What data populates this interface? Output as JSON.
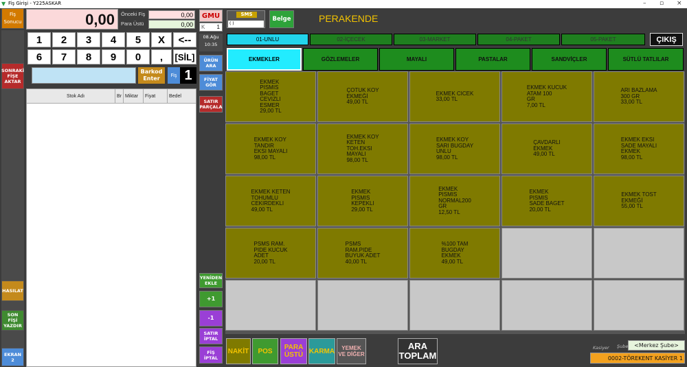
{
  "window": {
    "title": "Fiş Girişi - Y225ASKAR"
  },
  "left_rail": {
    "fis_sonucu": "Fiş Sonucu",
    "sonraki_fise_aktar": "SONRAKİ FİŞE AKTAR",
    "hasilat": "HASILAT",
    "son_fisi_yazdir": "SON FİŞİ YAZDIR",
    "ekran": "EKRAN 2"
  },
  "totals": {
    "total": "0,00",
    "onceki_fis_label": "Önceki Fiş",
    "onceki_fis_value": "0,00",
    "para_ustu_label": "Para Üstü",
    "para_ustu_value": "0,00"
  },
  "keypad": {
    "row1": [
      "1",
      "2",
      "3",
      "4",
      "5",
      "X",
      "<--"
    ],
    "row2": [
      "6",
      "7",
      "8",
      "9",
      "0",
      ",",
      "[SİL]"
    ]
  },
  "barcode": {
    "value": "",
    "enter_label": "Barkod Enter",
    "fis_label": "Fiş",
    "fis_number": "1"
  },
  "receipt": {
    "columns": [
      "Stok Adı",
      "Br",
      "Miktar",
      "Fiyat",
      "Bedel"
    ]
  },
  "mid_rail": {
    "gmu": "GMU",
    "k_label": "K",
    "k_value": "1",
    "date": "08.Ağu",
    "time": "10:35",
    "urun_ara": "ÜRÜN ARA",
    "fiyat_gor": "FİYAT GÖR",
    "satir_parcala": "SATIR PARÇALA",
    "yeniden_ekle": "YENİDEN EKLE",
    "plus1": "+1",
    "minus1": "-1",
    "satir_iptal": "SATIR İPTAL",
    "fis_iptal": "FİŞ İPTAL"
  },
  "top": {
    "sms_label": "SMS",
    "sms_value": "( )",
    "belge": "Belge",
    "mode": "PERAKENDE",
    "cikis": "ÇIKIŞ"
  },
  "categories": [
    "01-UNLU",
    "02-İÇECEK",
    "03-MARKET",
    "04-PAKET",
    "05-PAKET"
  ],
  "subcategories": [
    "EKMEKLER",
    "GÖZLEMELER",
    "MAYALI",
    "PASTALAR",
    "SANDVİÇLER",
    "SÜTLÜ TATLILAR"
  ],
  "products": [
    {
      "name": "EKMEK\nPISMIS\nBAGET\nCEVIZLI\nESMER",
      "price": "29,00 TL"
    },
    {
      "name": "ÇOTUK KOY\nEKMEĞİ",
      "price": "49,00 TL"
    },
    {
      "name": "EKMEK CICEK",
      "price": "33,00 TL"
    },
    {
      "name": "EKMEK KUCUK\nATAM 100\nGR",
      "price": "7,00 TL"
    },
    {
      "name": "ARI BAZLAMA\n300 GR",
      "price": "33,00 TL"
    },
    {
      "name": "EKMEK KOY\nTANDIR\nEKSI MAYALI",
      "price": "98,00 TL"
    },
    {
      "name": "EKMEK KOY\nKETEN\nTOH.EKSI\nMAYALI",
      "price": "98,00 TL"
    },
    {
      "name": "EKMEK KOY\nSARI BUGDAY\nUNLU",
      "price": "98,00 TL"
    },
    {
      "name": "ÇAVDARLI\nEKMEK",
      "price": "49,00 TL"
    },
    {
      "name": "EKMEK EKSI\nSADE MAYALI\nEKMEK",
      "price": "98,00 TL"
    },
    {
      "name": "EKMEK KETEN\nTOHUMLU\nCEKIRDEKLI",
      "price": "49,00 TL"
    },
    {
      "name": "EKMEK\nPISMIS\nKEPEKLI",
      "price": "29,00 TL"
    },
    {
      "name": "EKMEK\nPISMIS\nNORMAL200\nGR",
      "price": "12,50 TL"
    },
    {
      "name": "EKMEK\nPISMIS\nSADE BAGET",
      "price": "20,00 TL"
    },
    {
      "name": "EKMEK TOST\nEKMEĞİ",
      "price": "55,00 TL"
    },
    {
      "name": "PSMS RAM.\nPIDE KUCUK\nADET",
      "price": "20,00 TL"
    },
    {
      "name": "PSMS\nRAM.PIDE\nBUYUK ADET",
      "price": "40,00 TL"
    },
    {
      "name": "%100 TAM\nBUGDAY\nEKMEK",
      "price": "49,00 TL"
    }
  ],
  "payments": [
    "NAKİT",
    "POS",
    "PARA ÜSTÜ",
    "KARMA",
    "YEMEK VE DİĞER",
    "ARA TOPLAM"
  ],
  "footer": {
    "kasiyer_label": "Kasiyer",
    "sube_label": "Şube",
    "sube_value": "<Merkez Şube>",
    "kasiyer_value": "0002-TÖREKENT KASİYER 1"
  },
  "colors": {
    "product": "#7f7a00",
    "category": "#1f7f1f",
    "active": "#22d4ec",
    "mode": "#f3c300"
  }
}
